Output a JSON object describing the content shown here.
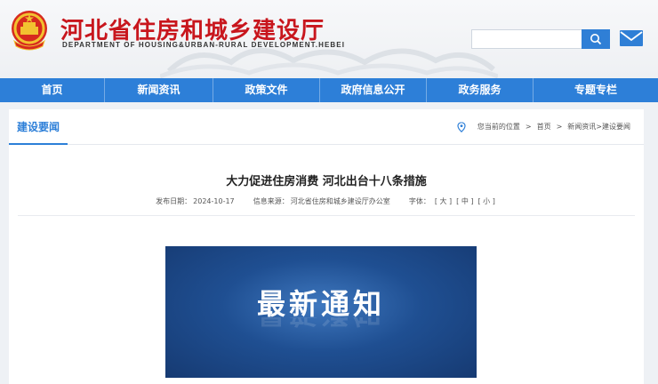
{
  "header": {
    "title": "河北省住房和城乡建设厅",
    "subtitle": "DEPARTMENT OF HOUSING&URBAN-RURAL DEVELOPMENT.HEBEI",
    "search_placeholder": ""
  },
  "nav": {
    "items": [
      {
        "label": "首页"
      },
      {
        "label": "新闻资讯"
      },
      {
        "label": "政策文件"
      },
      {
        "label": "政府信息公开"
      },
      {
        "label": "政务服务"
      },
      {
        "label": "专题专栏"
      }
    ]
  },
  "section": {
    "tab_label": "建设要闻",
    "breadcrumb": {
      "prefix": "您当前的位置",
      "sep": ">",
      "home": "首页",
      "path": "新闻资讯>建设要闻"
    }
  },
  "article": {
    "title": "大力促进住房消费 河北出台十八条措施",
    "date_label": "发布日期：",
    "date": "2024-10-17",
    "source_label": "信息来源：",
    "source": "河北省住房和城乡建设厅办公室",
    "font_label": "字体：",
    "font_large": "[ 大 ]",
    "font_medium": "[ 中 ]",
    "font_small": "[ 小 ]",
    "image_text": "最新通知"
  },
  "colors": {
    "brand_red": "#c8161d",
    "nav_blue": "#2d7fd8"
  }
}
